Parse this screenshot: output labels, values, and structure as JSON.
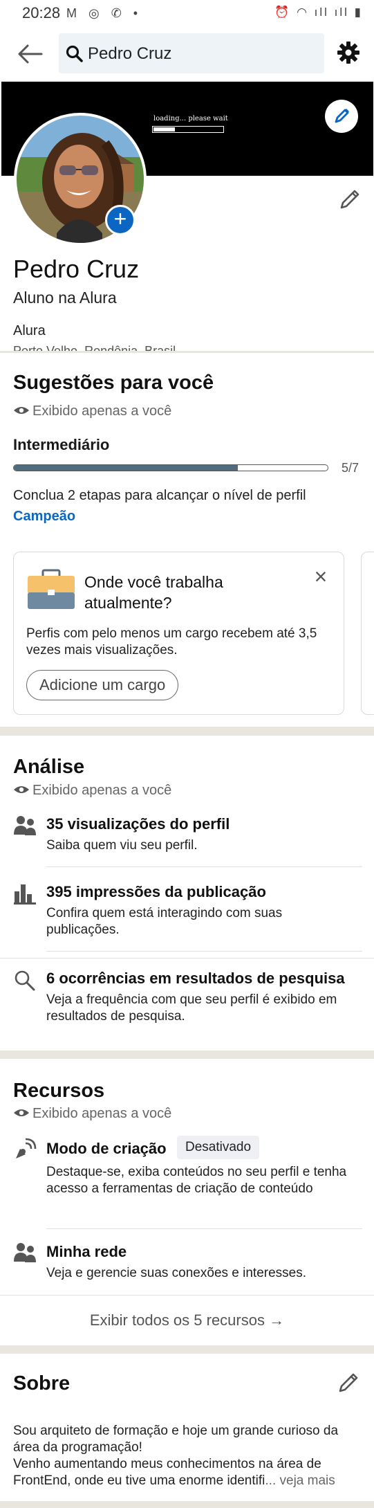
{
  "status_bar": {
    "time": "20:28",
    "left_icons": "M ◎ ✆ •",
    "right_icons": "⏰ ◠ ıll ıll ▮"
  },
  "search": {
    "value": "Pedro Cruz"
  },
  "banner": {
    "loading_text": "loading... please wait",
    "progress": 0.3
  },
  "profile": {
    "name": "Pedro Cruz",
    "headline": "Aluno na Alura",
    "company": "Alura",
    "location": "Porto Velho, Rondônia, Brasil"
  },
  "suggestions": {
    "title": "Sugestões para você",
    "private": "Exibido apenas a você",
    "level": "Intermediário",
    "progress_fraction": 0.714,
    "step": "5/7",
    "hint": "Conclua 2 etapas para alcançar o nível de perfil",
    "next_level": "Campeão",
    "card": {
      "title": "Onde você trabalha atualmente?",
      "description": "Perfis com pelo menos um cargo recebem até 3,5 vezes mais visualizações.",
      "button": "Adicione um cargo"
    }
  },
  "analytics": {
    "title": "Análise",
    "private": "Exibido apenas a você",
    "items": [
      {
        "title": "35 visualizações do perfil",
        "subtitle": "Saiba quem viu seu perfil.",
        "icon": "people-icon"
      },
      {
        "title": "395 impressões da publicação",
        "subtitle": "Confira quem está interagindo com suas publicações.",
        "icon": "bar-chart-icon"
      },
      {
        "title": "6 ocorrências em resultados de pesquisa",
        "subtitle": "Veja a frequência com que seu perfil é exibido em resultados de pesquisa.",
        "icon": "search-icon"
      }
    ]
  },
  "resources": {
    "title": "Recursos",
    "private": "Exibido apenas a você",
    "items": [
      {
        "title": "Modo de criação",
        "badge": "Desativado",
        "subtitle": "Destaque-se, exiba conteúdos no seu perfil e tenha acesso a ferramentas de criação de conteúdo",
        "icon": "satellite-icon"
      },
      {
        "title": "Minha rede",
        "subtitle": "Veja e gerencie suas conexões e interesses.",
        "icon": "people-icon"
      }
    ],
    "show_all": "Exibir todos os 5 recursos →"
  },
  "about": {
    "title": "Sobre",
    "text": "Sou arquiteto de formação e hoje um grande curioso da área da programação!\nVenho aumentando meus conhecimentos na área de FrontEnd, onde eu tive uma enorme identifi",
    "more": "... veja mais"
  },
  "colors": {
    "accent": "#0a66c2",
    "progress": "#4f6b7d",
    "separator": "#e9e5df"
  }
}
